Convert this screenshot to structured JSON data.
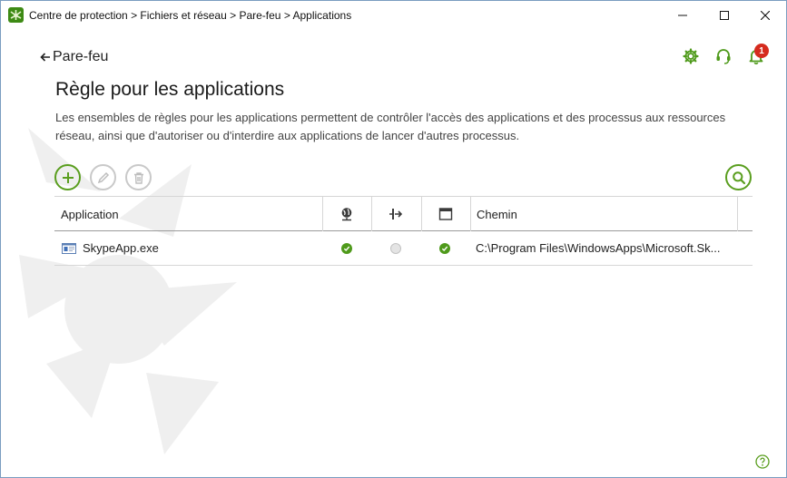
{
  "window": {
    "title": "Centre de protection > Fichiers et réseau > Pare-feu > Applications",
    "controls": [
      "minimize-icon",
      "maximize-icon",
      "close-icon"
    ]
  },
  "header": {
    "back_label": "Pare-feu",
    "icons": [
      "gear-icon",
      "headset-icon",
      "bell-icon"
    ],
    "notification_count": "1"
  },
  "page": {
    "title": "Règle pour les applications",
    "description": "Les ensembles de règles pour les applications permettent de contrôler l'accès des applications et des processus aux ressources réseau, ainsi que d'autoriser ou d'interdire aux applications de lancer d'autres processus."
  },
  "toolbar": {
    "buttons": [
      "plus-icon",
      "pencil-icon",
      "trash-icon",
      "search-icon"
    ]
  },
  "table": {
    "columns": {
      "application": "Application",
      "network_icon": "globe-network-icon",
      "process_icon": "process-launch-icon",
      "window_icon": "window-icon",
      "path": "Chemin"
    },
    "rows": [
      {
        "name": "SkypeApp.exe",
        "network": "allowed",
        "process": "inactive",
        "window": "allowed",
        "path": "C:\\Program Files\\WindowsApps\\Microsoft.Sk..."
      }
    ]
  },
  "colors": {
    "accent_green": "#5a9e1f",
    "status_green": "#4f9a1b",
    "badge_red": "#d52b1e"
  }
}
